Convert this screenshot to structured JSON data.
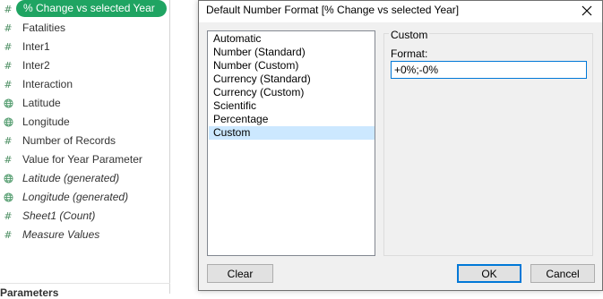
{
  "data_pane": {
    "fields": [
      {
        "label": "% Change vs selected Year",
        "icon": "measure-hash-icon",
        "selected": true,
        "generated": false
      },
      {
        "label": "Fatalities",
        "icon": "measure-hash-icon",
        "selected": false,
        "generated": false
      },
      {
        "label": "Inter1",
        "icon": "measure-hash-icon",
        "selected": false,
        "generated": false
      },
      {
        "label": "Inter2",
        "icon": "measure-hash-icon",
        "selected": false,
        "generated": false
      },
      {
        "label": "Interaction",
        "icon": "measure-hash-icon",
        "selected": false,
        "generated": false
      },
      {
        "label": "Latitude",
        "icon": "globe-icon",
        "selected": false,
        "generated": false
      },
      {
        "label": "Longitude",
        "icon": "globe-icon",
        "selected": false,
        "generated": false
      },
      {
        "label": "Number of Records",
        "icon": "measure-hash-icon",
        "selected": false,
        "generated": false
      },
      {
        "label": "Value for Year Parameter",
        "icon": "measure-hash-icon",
        "selected": false,
        "generated": false
      },
      {
        "label": "Latitude (generated)",
        "icon": "globe-icon",
        "selected": false,
        "generated": true
      },
      {
        "label": "Longitude (generated)",
        "icon": "globe-icon",
        "selected": false,
        "generated": true
      },
      {
        "label": "Sheet1 (Count)",
        "icon": "measure-hash-icon",
        "selected": false,
        "generated": true
      },
      {
        "label": "Measure Values",
        "icon": "measure-hash-icon",
        "selected": false,
        "generated": true
      }
    ],
    "parameters_title": "Parameters",
    "accent_color": "#1fa462"
  },
  "dialog": {
    "title": "Default Number Format [% Change vs selected Year]",
    "format_types": [
      "Automatic",
      "Number (Standard)",
      "Number (Custom)",
      "Currency (Standard)",
      "Currency (Custom)",
      "Scientific",
      "Percentage",
      "Custom"
    ],
    "selected_format": "Custom",
    "custom_group_label": "Custom",
    "format_label": "Format:",
    "format_value": "+0%;-0%",
    "clear_label": "Clear",
    "ok_label": "OK",
    "cancel_label": "Cancel",
    "selection_color": "#cce8ff"
  }
}
